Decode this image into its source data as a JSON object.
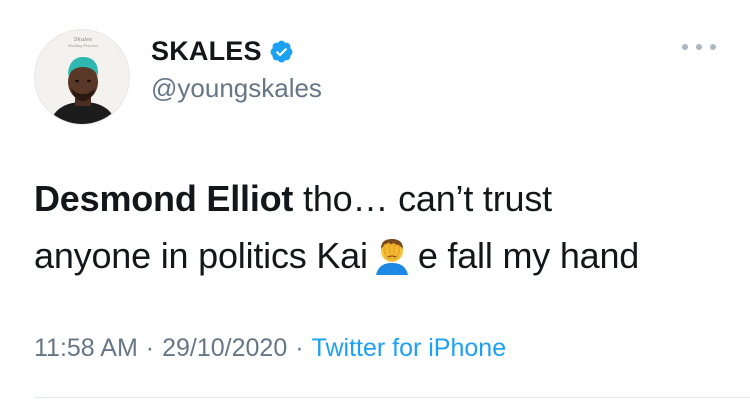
{
  "tweet": {
    "author": {
      "display_name": "SKALES",
      "handle": "@youngskales",
      "avatar_caption": "Skales",
      "avatar_caption_small": "Healing Process"
    },
    "text_bold": "Desmond Elliot",
    "text_line1_rest": " tho… can’t trust",
    "text_line2_before_emoji": "anyone in politics Kai",
    "emoji": "face-palm-emoji",
    "text_line2_after_emoji": "e fall my hand",
    "time": "11:58 AM",
    "separator": "·",
    "date": "29/10/2020",
    "source": "Twitter for iPhone"
  },
  "colors": {
    "text": "#14171a",
    "secondary": "#657786",
    "link": "#1da1f2",
    "verified": "#1da1f2"
  },
  "icons": {
    "verified": "verified-badge-icon",
    "more": "more-options-icon"
  }
}
